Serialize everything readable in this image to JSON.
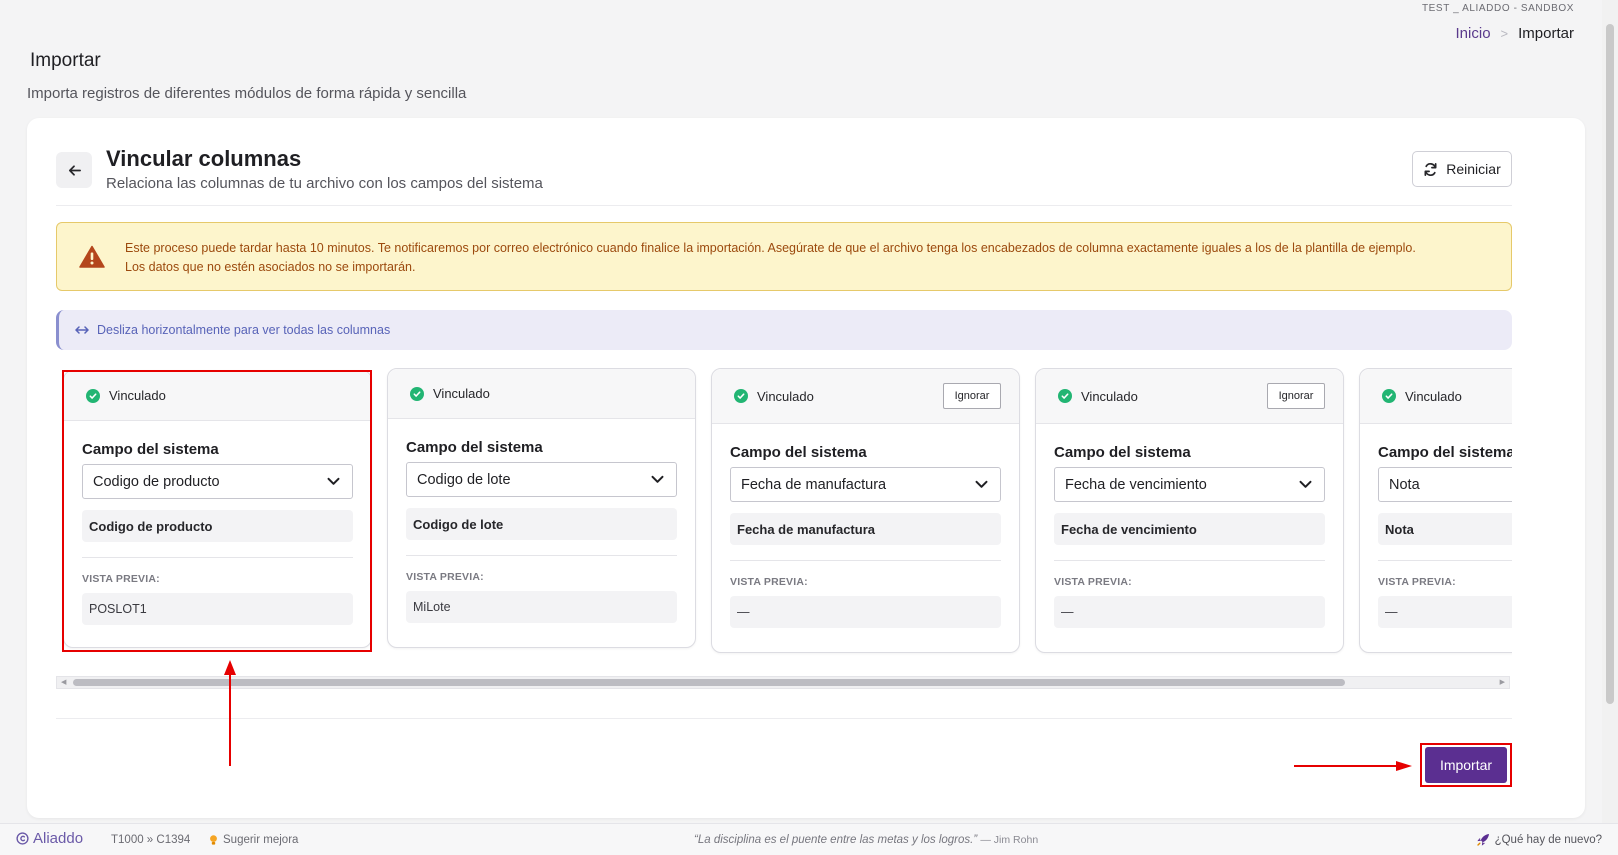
{
  "env_label": "TEST _ ALIADDO - SANDBOX",
  "breadcrumb": {
    "home": "Inicio",
    "separator": ">",
    "current": "Importar"
  },
  "page": {
    "title": "Importar",
    "subtitle": "Importa registros de diferentes módulos de forma rápida y sencilla"
  },
  "section": {
    "title": "Vincular columnas",
    "subtitle": "Relaciona las columnas de tu archivo con los campos del sistema",
    "reset_label": "Reiniciar"
  },
  "warning": {
    "line1": "Este proceso puede tardar hasta 10 minutos. Te notificaremos por correo electrónico cuando finalice la importación. Asegúrate de que el archivo tenga los encabezados de columna exactamente iguales a los de la plantilla de ejemplo.",
    "line2": "Los datos que no estén asociados no se importarán."
  },
  "info_text": "Desliza horizontalmente para ver todas las columnas",
  "columns": [
    {
      "status": "Vinculado",
      "ignore_label": "",
      "field_label": "Campo del sistema",
      "selected": "Codigo de producto",
      "mapped": "Codigo de producto",
      "preview_label": "VISTA PREVIA:",
      "preview": "POSLOT1"
    },
    {
      "status": "Vinculado",
      "ignore_label": "",
      "field_label": "Campo del sistema",
      "selected": "Codigo de lote",
      "mapped": "Codigo de lote",
      "preview_label": "VISTA PREVIA:",
      "preview": "MiLote"
    },
    {
      "status": "Vinculado",
      "ignore_label": "Ignorar",
      "field_label": "Campo del sistema",
      "selected": "Fecha de manufactura",
      "mapped": "Fecha de manufactura",
      "preview_label": "VISTA PREVIA:",
      "preview": "—"
    },
    {
      "status": "Vinculado",
      "ignore_label": "Ignorar",
      "field_label": "Campo del sistema",
      "selected": "Fecha de vencimiento",
      "mapped": "Fecha de vencimiento",
      "preview_label": "VISTA PREVIA:",
      "preview": "—"
    },
    {
      "status": "Vinculado",
      "ignore_label": "",
      "field_label": "Campo del sistema",
      "selected": "Nota",
      "mapped": "Nota",
      "preview_label": "VISTA PREVIA:",
      "preview": "—"
    }
  ],
  "import_label": "Importar",
  "footer": {
    "brand": "Aliaddo",
    "code": "T1000 » C1394",
    "suggest": "Sugerir mejora",
    "quote": "La disciplina es el puente entre las metas y los logros.",
    "author": "— Jim Rohn",
    "news": "¿Qué hay de nuevo?"
  },
  "colors": {
    "primary": "#5b2f91",
    "success": "#22b573",
    "warning_bg": "#fdf5cc",
    "warning_text": "#9c4a0e",
    "info_bg": "#ecebf7",
    "annotation_red": "#e60000"
  },
  "icons": {
    "back": "arrow-left-icon",
    "reset": "refresh-icon",
    "warning": "warning-triangle-icon",
    "info": "horizontal-arrows-icon",
    "status": "check-circle-icon",
    "select": "chevron-down-icon",
    "suggest": "lightbulb-icon",
    "news": "rocket-icon"
  }
}
